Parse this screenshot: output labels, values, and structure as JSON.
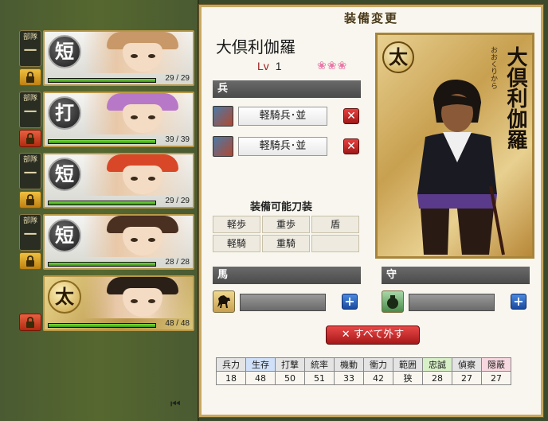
{
  "roster": [
    {
      "squad_label": "部隊",
      "squad_num": "一",
      "type": "短",
      "hp": "29 / 29",
      "hp_frac": 1.0,
      "lock": "gold",
      "hair": "#c89868"
    },
    {
      "squad_label": "部隊",
      "squad_num": "一",
      "type": "打",
      "hp": "39 / 39",
      "hp_frac": 1.0,
      "lock": "red",
      "hair": "#b878c8"
    },
    {
      "squad_label": "部隊",
      "squad_num": "一",
      "type": "短",
      "hp": "29 / 29",
      "hp_frac": 1.0,
      "lock": "gold",
      "hair": "#d84828"
    },
    {
      "squad_label": "部隊",
      "squad_num": "一",
      "type": "短",
      "hp": "28 / 28",
      "hp_frac": 1.0,
      "lock": "gold",
      "hair": "#4a3020"
    },
    {
      "squad_label": "",
      "squad_num": "",
      "type": "太",
      "hp": "48 / 48",
      "hp_frac": 1.0,
      "lock": "red",
      "hair": "#2a2018"
    }
  ],
  "panel": {
    "title": "装備変更",
    "unit_name": "大倶利伽羅",
    "lv_label": "Lv",
    "lv_value": "1",
    "petals": "❀❀❀",
    "troops_head": "兵",
    "troops": [
      "軽騎兵･並",
      "軽騎兵･並"
    ],
    "equip_title": "装備可能刀装",
    "equip_types": [
      "軽歩",
      "重歩",
      "盾",
      "軽騎",
      "重騎",
      ""
    ],
    "horse_head": "馬",
    "charm_head": "守",
    "unequip_all": "✕ すべて外す",
    "card_type": "太",
    "card_name": "大倶利伽羅",
    "card_kana": "おおくりから"
  },
  "stats": {
    "headers": [
      "兵力",
      "生存",
      "打撃",
      "統率",
      "機動",
      "衝力",
      "範囲",
      "忠誠",
      "偵察",
      "隠蔽"
    ],
    "values": [
      "18",
      "48",
      "50",
      "51",
      "33",
      "42",
      "狭",
      "28",
      "27",
      "27"
    ]
  },
  "colors": {
    "accent_gold": "#c8a860",
    "danger": "#c02020",
    "hp_green": "#5ac030"
  }
}
